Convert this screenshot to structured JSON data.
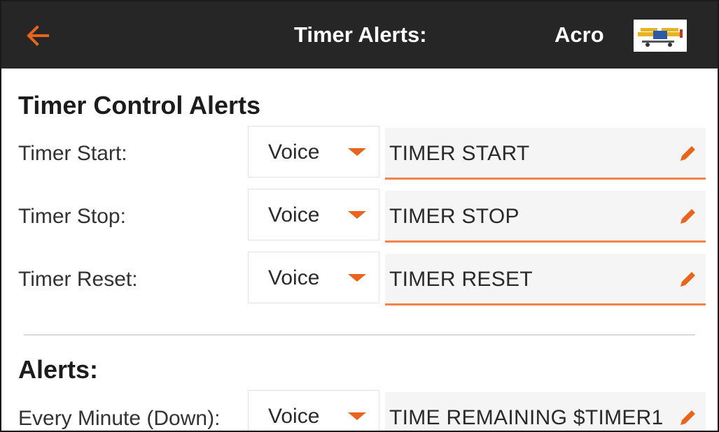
{
  "header": {
    "title": "Timer Alerts:",
    "model_name": "Acro",
    "back_icon": "arrow-left-icon",
    "model_image_icon": "airplane-thumbnail-icon",
    "accent_color": "#e8651e",
    "bar_color": "#262626"
  },
  "timer_control": {
    "heading": "Timer Control Alerts",
    "rows": [
      {
        "label": "Timer Start:",
        "mode": "Voice",
        "text": "TIMER START"
      },
      {
        "label": "Timer Stop:",
        "mode": "Voice",
        "text": "TIMER STOP"
      },
      {
        "label": "Timer Reset:",
        "mode": "Voice",
        "text": "TIMER RESET"
      }
    ]
  },
  "alerts": {
    "heading": "Alerts:",
    "rows": [
      {
        "label": "Every Minute (Down):",
        "mode": "Voice",
        "text": "TIME REMAINING $TIMER1"
      }
    ]
  }
}
